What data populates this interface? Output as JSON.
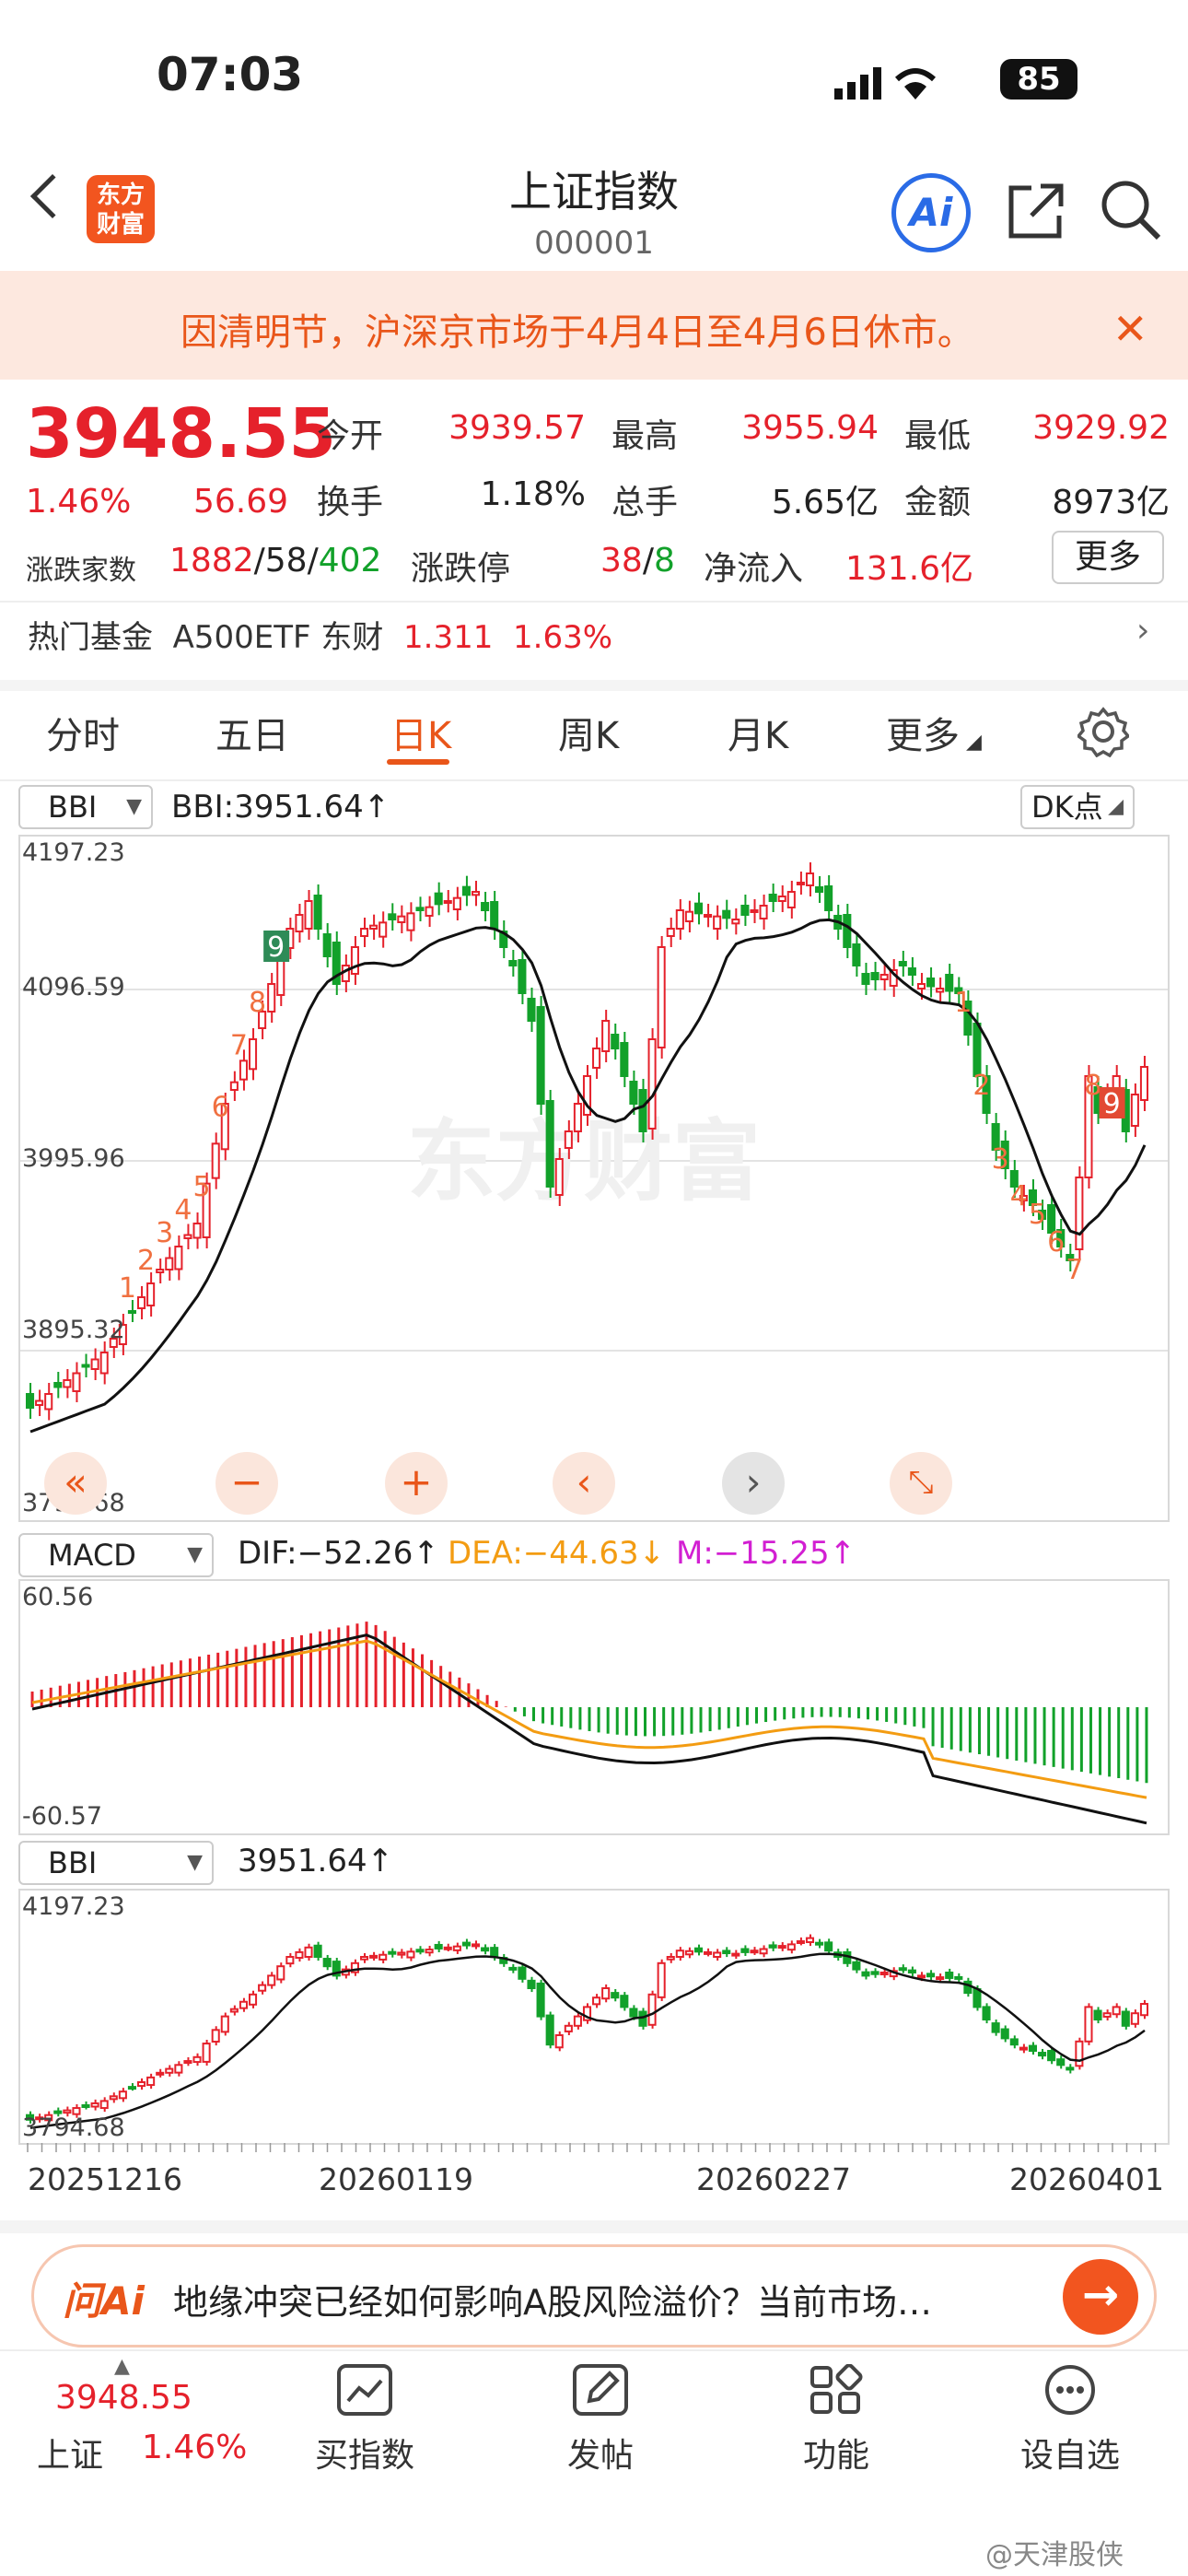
{
  "status_bar": {
    "time": "07:03",
    "battery": "85"
  },
  "header": {
    "logo_text": "东方财富",
    "title": "上证指数",
    "code": "000001"
  },
  "notice": {
    "text": "因清明节，沪深京市场于4月4日至4月6日休市。"
  },
  "quote": {
    "price": "3948.55",
    "change_pct": "1.46%",
    "change": "56.69",
    "fields": [
      {
        "label": "今开",
        "value": "3939.57"
      },
      {
        "label": "最高",
        "value": "3955.94"
      },
      {
        "label": "最低",
        "value": "3929.92"
      },
      {
        "label": "换手",
        "value": "1.18%"
      },
      {
        "label": "总手",
        "value": "5.65亿"
      },
      {
        "label": "金额",
        "value": "8973亿"
      }
    ],
    "breadth_label": "涨跌家数",
    "breadth_up": "1882",
    "breadth_flat": "58",
    "breadth_down": "402",
    "limit_label": "涨跌停",
    "limit_up": "38",
    "limit_down": "8",
    "netflow_label": "净流入",
    "netflow_value": "131.6亿",
    "more_label": "更多"
  },
  "hot_fund": {
    "label": "热门基金",
    "name": "A500ETF 东财",
    "price": "1.311",
    "change": "1.63%"
  },
  "tabs": [
    "分时",
    "五日",
    "日K",
    "周K",
    "月K",
    "更多"
  ],
  "active_tab": "日K",
  "main_chart": {
    "indicator": "BBI",
    "indicator_value": "BBI:3951.64↑",
    "dk_label": "DK点",
    "y_ticks": [
      "4197.23",
      "4096.59",
      "3995.96",
      "3895.32",
      "3794.68"
    ],
    "watermark": "东方财富",
    "seq_up": [
      "1",
      "2",
      "3",
      "4",
      "5",
      "6",
      "7",
      "8",
      "9"
    ],
    "seq_down": [
      "1",
      "2",
      "3",
      "4",
      "5",
      "6",
      "7",
      "8",
      "9"
    ]
  },
  "macd": {
    "indicator": "MACD",
    "dif": "DIF:−52.26↑",
    "dea": "DEA:−44.63↓",
    "m": "M:−15.25↑",
    "y_top": "60.56",
    "y_bottom": "-60.57"
  },
  "mini_chart": {
    "indicator": "BBI",
    "value": "3951.64↑",
    "y_top": "4197.23",
    "y_bottom": "3794.68"
  },
  "dates": [
    "20251216",
    "20260119",
    "20260227",
    "20260401"
  ],
  "ask_bar": {
    "brand": "问Ai",
    "text": "地缘冲突已经如何影响A股风险溢价？当前市场…"
  },
  "bottom_nav": {
    "index_price": "3948.55",
    "index_name": "上证",
    "index_change": "1.46%",
    "items": [
      "买指数",
      "发帖",
      "功能",
      "设自选"
    ]
  },
  "footer_watermark": "@天津股侠",
  "colors": {
    "up": "#e5212b",
    "down": "#12a12a",
    "accent": "#e9561a"
  }
}
